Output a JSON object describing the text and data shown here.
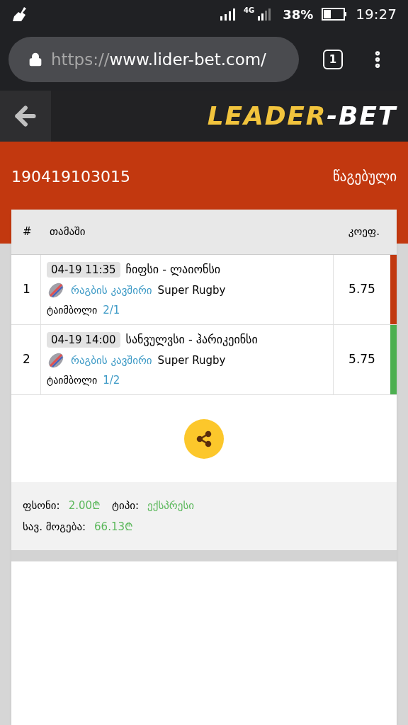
{
  "status_bar": {
    "network": "4G",
    "battery": "38%",
    "time": "19:27"
  },
  "browser": {
    "url_scheme": "https://",
    "url_rest": "www.lider-bet.com/",
    "tab_count": "1"
  },
  "header": {
    "logo_main": "LEADER",
    "logo_dash": "-",
    "logo_end": "BET"
  },
  "ticket": {
    "id": "190419103015",
    "status": "წაგებული"
  },
  "table": {
    "columns": [
      "#",
      "თამაში",
      "კოეფ."
    ],
    "rows": [
      {
        "index": "1",
        "datetime": "04-19 11:35",
        "match": "ჩიფსი - ლაიონსი",
        "sport": "რაგბის კავშირი",
        "league": "Super Rugby",
        "market": "ტაიმბოლი",
        "pick": "2/1",
        "odds": "5.75",
        "color": "#c1380f"
      },
      {
        "index": "2",
        "datetime": "04-19 14:00",
        "match": "სანვულვსი - ჰარიკეინსი",
        "sport": "რაგბის კავშირი",
        "league": "Super Rugby",
        "market": "ტაიმბოლი",
        "pick": "1/2",
        "odds": "5.75",
        "color": "#4caf50"
      }
    ]
  },
  "summary": {
    "stake_label": "ფსონი:",
    "stake": "2.00₾",
    "type_label": "ტიპი:",
    "type": "ექსპრესი",
    "win_label": "სავ. მოგება:",
    "win": "66.13₾"
  }
}
